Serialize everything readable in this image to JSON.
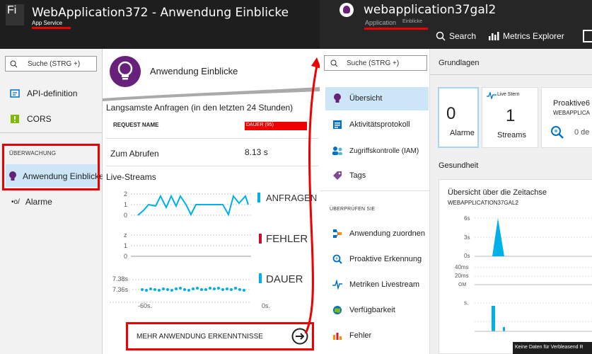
{
  "left_header": {
    "app_icon": "Fi",
    "title": "WebApplication372 - Anwendung Einblicke",
    "subtitle": "App Service"
  },
  "right_header": {
    "title": "webapplication37gal2",
    "subtitle_a": "Application",
    "subtitle_b": "Einblicke",
    "search_label": "Search",
    "metrics_label": "Metrics Explorer"
  },
  "nav1": {
    "search_placeholder": "Suche (STRG +)",
    "items": [
      {
        "label": "API-definition",
        "icon": "api-icon"
      },
      {
        "label": "CORS",
        "icon": "cors-icon"
      }
    ],
    "section": "ÜBERWACHUNG",
    "monitor_items": [
      {
        "label": "Anwendung Einblicke",
        "icon": "bulb-icon"
      },
      {
        "label": "Alarme",
        "icon": "alarm-icon",
        "prefix": "•o/"
      }
    ]
  },
  "blade2": {
    "title": "Anwendung Einblicke",
    "slow_title": "Langsamste Anfragen (in den letzten 24 Stunden)",
    "col_request": "REQUEST NAME",
    "col_duration": "DAUER (95)",
    "row_name": "Zum Abrufen",
    "row_value": "8.13 s",
    "live_title": "Live-Streams",
    "requests_label": "ANFRAGEN",
    "requests_ticks": [
      "2",
      "1",
      "0"
    ],
    "errors_label": "FEHLER",
    "errors_ticks": [
      "z",
      "1",
      "0"
    ],
    "duration_label": "DAUER",
    "duration_ticks": [
      "7.38s",
      "7.36s"
    ],
    "x_start": "-60s.",
    "x_end": "0s.",
    "more_button": "MEHR ANWENDUNG ERKENNTNISSE"
  },
  "nav3": {
    "search_placeholder": "Suche (STRG +)",
    "items": [
      {
        "label": "Übersicht",
        "icon": "bulb-icon"
      },
      {
        "label": "Aktivitätsprotokoll",
        "icon": "log-icon"
      },
      {
        "label": "Zugriffskontrolle (IAM)",
        "icon": "iam-icon"
      },
      {
        "label": "Tags",
        "icon": "tag-icon"
      }
    ],
    "section": "ÜBERPRÜFEN SIE",
    "review_items": [
      {
        "label": "Anwendung zuordnen",
        "icon": "map-icon"
      },
      {
        "label": "Proaktive Erkennung",
        "icon": "detect-icon"
      },
      {
        "label": "Metriken Livestream",
        "icon": "pulse-icon"
      },
      {
        "label": "Verfügbarkeit",
        "icon": "globe-icon"
      },
      {
        "label": "Fehler",
        "icon": "chart-icon"
      }
    ]
  },
  "blade4": {
    "grundlagen": "Grundlagen",
    "alarme_value": "0",
    "alarme_label": "Alarme",
    "streams_top": "Live Stern",
    "streams_value": "1",
    "streams_label": "Streams",
    "proactive_title": "Proaktive6",
    "proactive_sub": "WEBAPPLICA",
    "proactive_value": "0 de",
    "health": "Gesundheit",
    "timeline_title": "Übersicht über die Zeitachse",
    "timeline_sub": "WEBAPPLICATION37GAL2",
    "ticks_a": [
      "6s",
      "3s",
      "0s"
    ],
    "ticks_b": [
      "40ms",
      "20ms",
      "OM"
    ],
    "ticks_c": [
      "s,"
    ],
    "footer": "Keine Daten für Verbleasend R"
  },
  "colors": {
    "accent": "#00b0e8",
    "red": "#e00000",
    "purple": "#68217a"
  }
}
